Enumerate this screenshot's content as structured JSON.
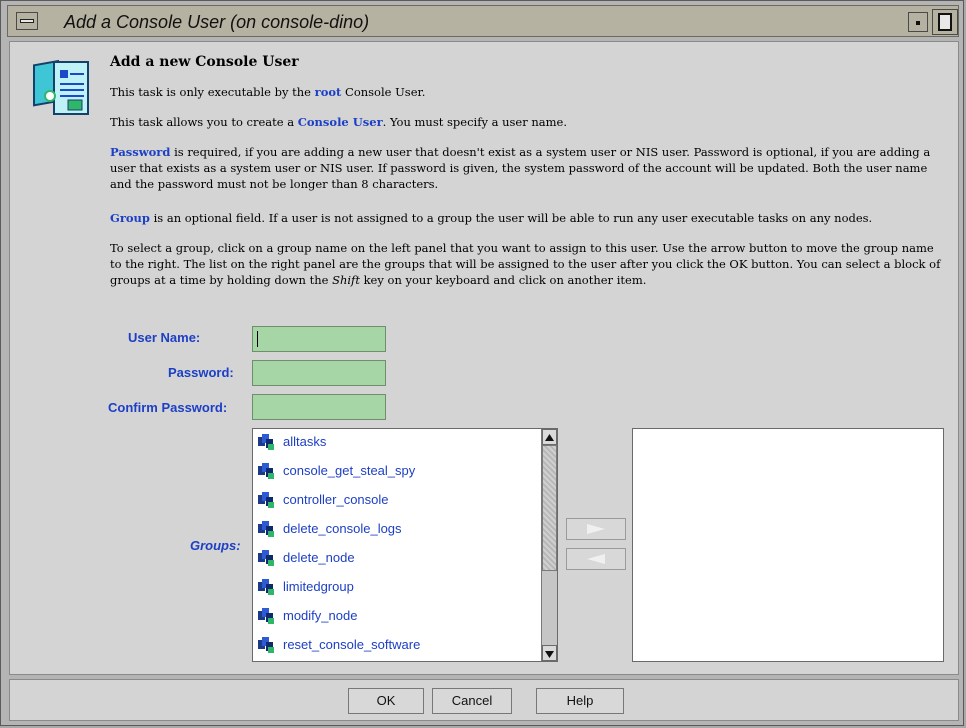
{
  "window": {
    "title": "Add a Console User (on console-dino)"
  },
  "heading": "Add a new Console User",
  "intro": {
    "p1_a": "This task is only executable by the ",
    "p1_kw": "root",
    "p1_b": " Console User.",
    "p2_a": "This task allows you to create a ",
    "p2_kw": "Console User",
    "p2_b": ".  You must specify a user name.",
    "p3_kw": "Password",
    "p3_b": " is required, if you are adding a new user that doesn't exist as a system user or NIS user. Password is optional, if you are adding a user that exists as a system user or NIS user. If password is given, the system password of the account will be updated. Both the user name and the password must not be longer than 8 characters.",
    "p4_kw": "Group",
    "p4_b": " is an optional field. If a user is not assigned to a group the user will be able to run any user executable tasks on any nodes.",
    "p5_a": "To select a group, click on a group name on the left panel that you want to assign to this user. Use the arrow button to move the group name to the right. The list on the right panel are the groups that will be assigned to the user after you click the OK button. You can select a block of groups at a time by holding down the ",
    "p5_em": "Shift",
    "p5_b": " key on your keyboard and click on another item."
  },
  "form": {
    "user_name_label": "User Name:",
    "user_name_value": "",
    "password_label": "Password:",
    "password_value": "",
    "confirm_label": "Confirm Password:",
    "confirm_value": "",
    "groups_label": "Groups:"
  },
  "groups": [
    "alltasks",
    "console_get_steal_spy",
    "controller_console",
    "delete_console_logs",
    "delete_node",
    "limitedgroup",
    "modify_node",
    "reset_console_software"
  ],
  "buttons": {
    "ok": "OK",
    "cancel": "Cancel",
    "help": "Help"
  },
  "colors": {
    "keyword": "#1c3fc6",
    "field_bg": "#a6d6a6",
    "panel_bg": "#d4d4d4"
  }
}
